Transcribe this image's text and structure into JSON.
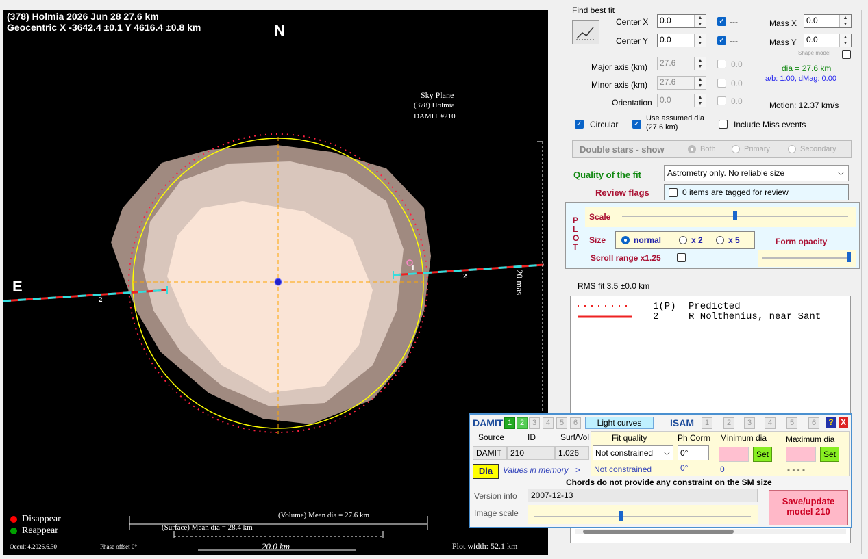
{
  "plot": {
    "title_line1": "(378) Holmia  2026 Jun 28   27.6 km",
    "title_line2": "Geocentric X  -3642.4 ±0.1  Y 4616.4 ±0.8 km",
    "north": "N",
    "east": "E",
    "sky_plane": [
      "Sky Plane",
      "(378) Holmia",
      "DAMIT #210"
    ],
    "scale_label": "20 mas",
    "chord_labels": [
      "2",
      "2",
      "1",
      "2"
    ],
    "legend_disappear": "Disappear",
    "legend_reappear": "Reappear",
    "volume_dia": "(Volume) Mean dia = 27.6 km",
    "surface_dia": "(Surface) Mean dia = 28.4 km",
    "scale_km": "20.0 km",
    "version": "Occult 4.2026.6.30",
    "phase_offset": "Phase offset 0°",
    "plot_width": "Plot width: 52.1 km",
    "colors": {
      "disappear": "#ff0000",
      "reappear": "#00a000",
      "fit_circle": "#ffff00",
      "axes": "#ffa500",
      "chord_dash": "#33dddd"
    }
  },
  "fit": {
    "group_label": "Find best fit",
    "center_x_label": "Center X",
    "center_x": "0.0",
    "center_y_label": "Center Y",
    "center_y": "0.0",
    "mass_x_label": "Mass X",
    "mass_x": "0.0",
    "mass_y_label": "Mass Y",
    "mass_y": "0.0",
    "cb_dash": "---",
    "shape_model": "Shape model",
    "major_label": "Major axis (km)",
    "major": "27.6",
    "minor_label": "Minor axis (km)",
    "minor": "27.6",
    "orient_label": "Orientation",
    "orient": "0.0",
    "zero": "0.0",
    "dia": "dia = 27.6 km",
    "ab": "a/b: 1.00, dMag: 0.00",
    "motion": "Motion: 12.37 km/s",
    "circular": "Circular",
    "use_assumed": "Use assumed dia (27.6 km)",
    "include_miss": "Include Miss events"
  },
  "double_stars": {
    "label": "Double stars - show",
    "both": "Both",
    "primary": "Primary",
    "secondary": "Secondary"
  },
  "quality": {
    "label": "Quality of the fit",
    "value": "Astrometry only. No reliable size"
  },
  "review": {
    "label": "Review flags",
    "value": "0 items are tagged for review"
  },
  "plotctl": {
    "side": [
      "P",
      "L",
      "O",
      "T"
    ],
    "scale": "Scale",
    "size": "Size",
    "normal": "normal",
    "x2": "x 2",
    "x5": "x 5",
    "form_opacity": "Form opacity",
    "scroll": "Scroll range x1.25",
    "scale_level": 0.5,
    "opacity_level": 1.0
  },
  "rms": "RMS fit 3.5 ±0.0 km",
  "chords": [
    {
      "id": "1(P)",
      "name": "Predicted"
    },
    {
      "id": "2",
      "name": "R Nolthenius, near Sant"
    }
  ],
  "damit": {
    "title": "DAMIT",
    "tabs": [
      "1",
      "2",
      "3",
      "4",
      "5",
      "6"
    ],
    "light_curves": "Light curves",
    "isam": "ISAM",
    "isam_tabs": [
      "1",
      "2",
      "3",
      "4",
      "5",
      "6"
    ],
    "help": "?",
    "close": "X",
    "source_label": "Source",
    "id_label": "ID",
    "surf_label": "Surf/Vol",
    "source": "DAMIT",
    "id": "210",
    "surf": "1.026",
    "fit_quality_label": "Fit quality",
    "fit_quality": "Not constrained",
    "fit_quality_mem": "Not constrained",
    "ph_corrn_label": "Ph Corrn",
    "ph_corrn": "0°",
    "ph_corrn_mem": "0°",
    "min_dia_label": "Minimum dia",
    "max_dia_label": "Maximum dia",
    "min_mem": "0",
    "max_mem": "- - - -",
    "set": "Set",
    "dia_btn": "Dia",
    "values_mem": "Values in memory =>",
    "chords_note": "Chords do not provide any constraint on the SM size",
    "version_label": "Version info",
    "version": "2007-12-13",
    "image_scale_label": "Image scale",
    "image_scale_level": 0.4,
    "save": "Save/update model 210"
  }
}
